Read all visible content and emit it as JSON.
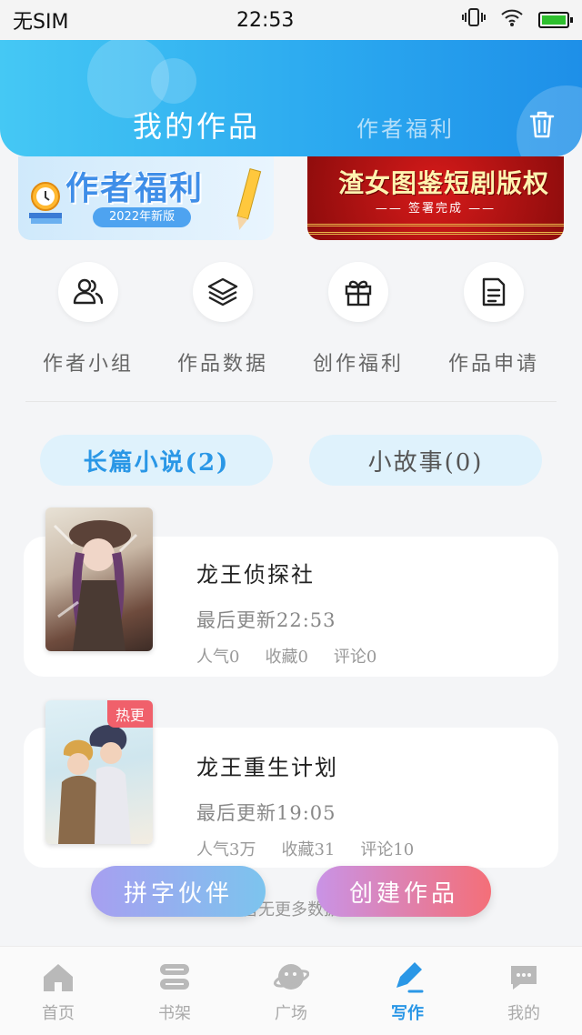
{
  "status_bar": {
    "carrier": "无SIM",
    "time": "22:53"
  },
  "header": {
    "tab_active": "我的作品",
    "tab_inactive": "作者福利"
  },
  "banners": {
    "left": {
      "title": "作者福利",
      "subtitle": "2022年新版"
    },
    "right": {
      "title": "渣女图鉴短剧版权",
      "subtitle": "—— 签署完成 ——"
    }
  },
  "quick_actions": [
    {
      "label": "作者小组",
      "icon": "group-icon"
    },
    {
      "label": "作品数据",
      "icon": "layers-icon"
    },
    {
      "label": "创作福利",
      "icon": "gift-icon"
    },
    {
      "label": "作品申请",
      "icon": "document-icon"
    }
  ],
  "categories": {
    "long_novel": "长篇小说(2)",
    "short_story": "小故事(0)"
  },
  "works": [
    {
      "title": "龙王侦探社",
      "updated": "最后更新22:53",
      "popularity": "人气0",
      "favorites": "收藏0",
      "comments": "评论0",
      "badge": ""
    },
    {
      "title": "龙王重生计划",
      "updated": "最后更新19:05",
      "popularity": "人气3万",
      "favorites": "收藏31",
      "comments": "评论10",
      "badge": "热更"
    }
  ],
  "no_more": "暂无更多数据",
  "floating_buttons": {
    "partner": "拼字伙伴",
    "create": "创建作品"
  },
  "bottom_nav": [
    {
      "label": "首页",
      "icon": "home-icon",
      "active": false
    },
    {
      "label": "书架",
      "icon": "bookshelf-icon",
      "active": false
    },
    {
      "label": "广场",
      "icon": "planet-icon",
      "active": false
    },
    {
      "label": "写作",
      "icon": "pen-icon",
      "active": true
    },
    {
      "label": "我的",
      "icon": "chat-icon",
      "active": false
    }
  ],
  "colors": {
    "accent": "#2a97e6",
    "header_start": "#45c8f4",
    "header_end": "#1e8fe8",
    "hot_badge": "#f0606b"
  }
}
